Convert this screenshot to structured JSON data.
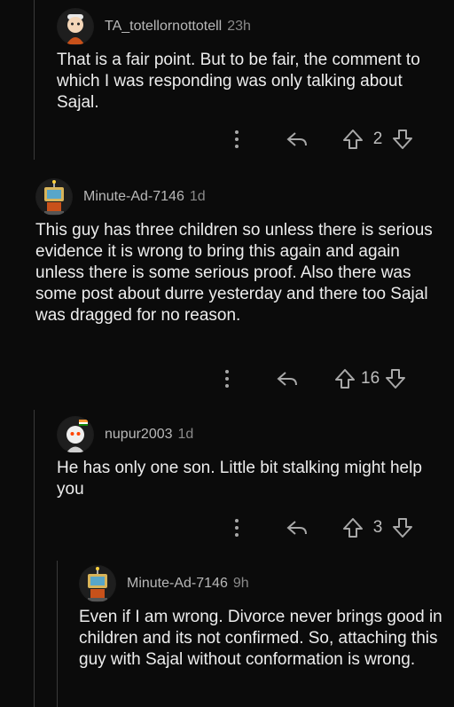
{
  "comments": [
    {
      "username": "TA_totellornottotell",
      "age": "23h",
      "body": "That is a fair point. But to be fair, the comment to which I was responding was only talking about Sajal.",
      "score": "2",
      "avatar_icon": "snoo-avatar-icon"
    },
    {
      "username": "Minute-Ad-7146",
      "age": "1d",
      "body": "This guy has three children so unless there is serious evidence it is wrong to bring this again and again unless there is some serious proof. Also there was some post about durre yesterday and there too Sajal was dragged for no reason.",
      "score": "16",
      "avatar_icon": "robot-avatar-icon"
    },
    {
      "username": "nupur2003",
      "age": "1d",
      "body": "He has only one son. Little bit stalking might help you",
      "score": "3",
      "avatar_icon": "snoo-avatar-icon"
    },
    {
      "username": "Minute-Ad-7146",
      "age": "9h",
      "body": "Even if I am wrong. Divorce never brings good in children and its not confirmed. So, attaching this guy with Sajal without conformation is wrong.",
      "avatar_icon": "robot-avatar-icon"
    }
  ],
  "colors": {
    "background": "#0b0b0b",
    "text": "#ededed",
    "meta": "#8a8a8a",
    "rail": "#3a3a3a"
  }
}
